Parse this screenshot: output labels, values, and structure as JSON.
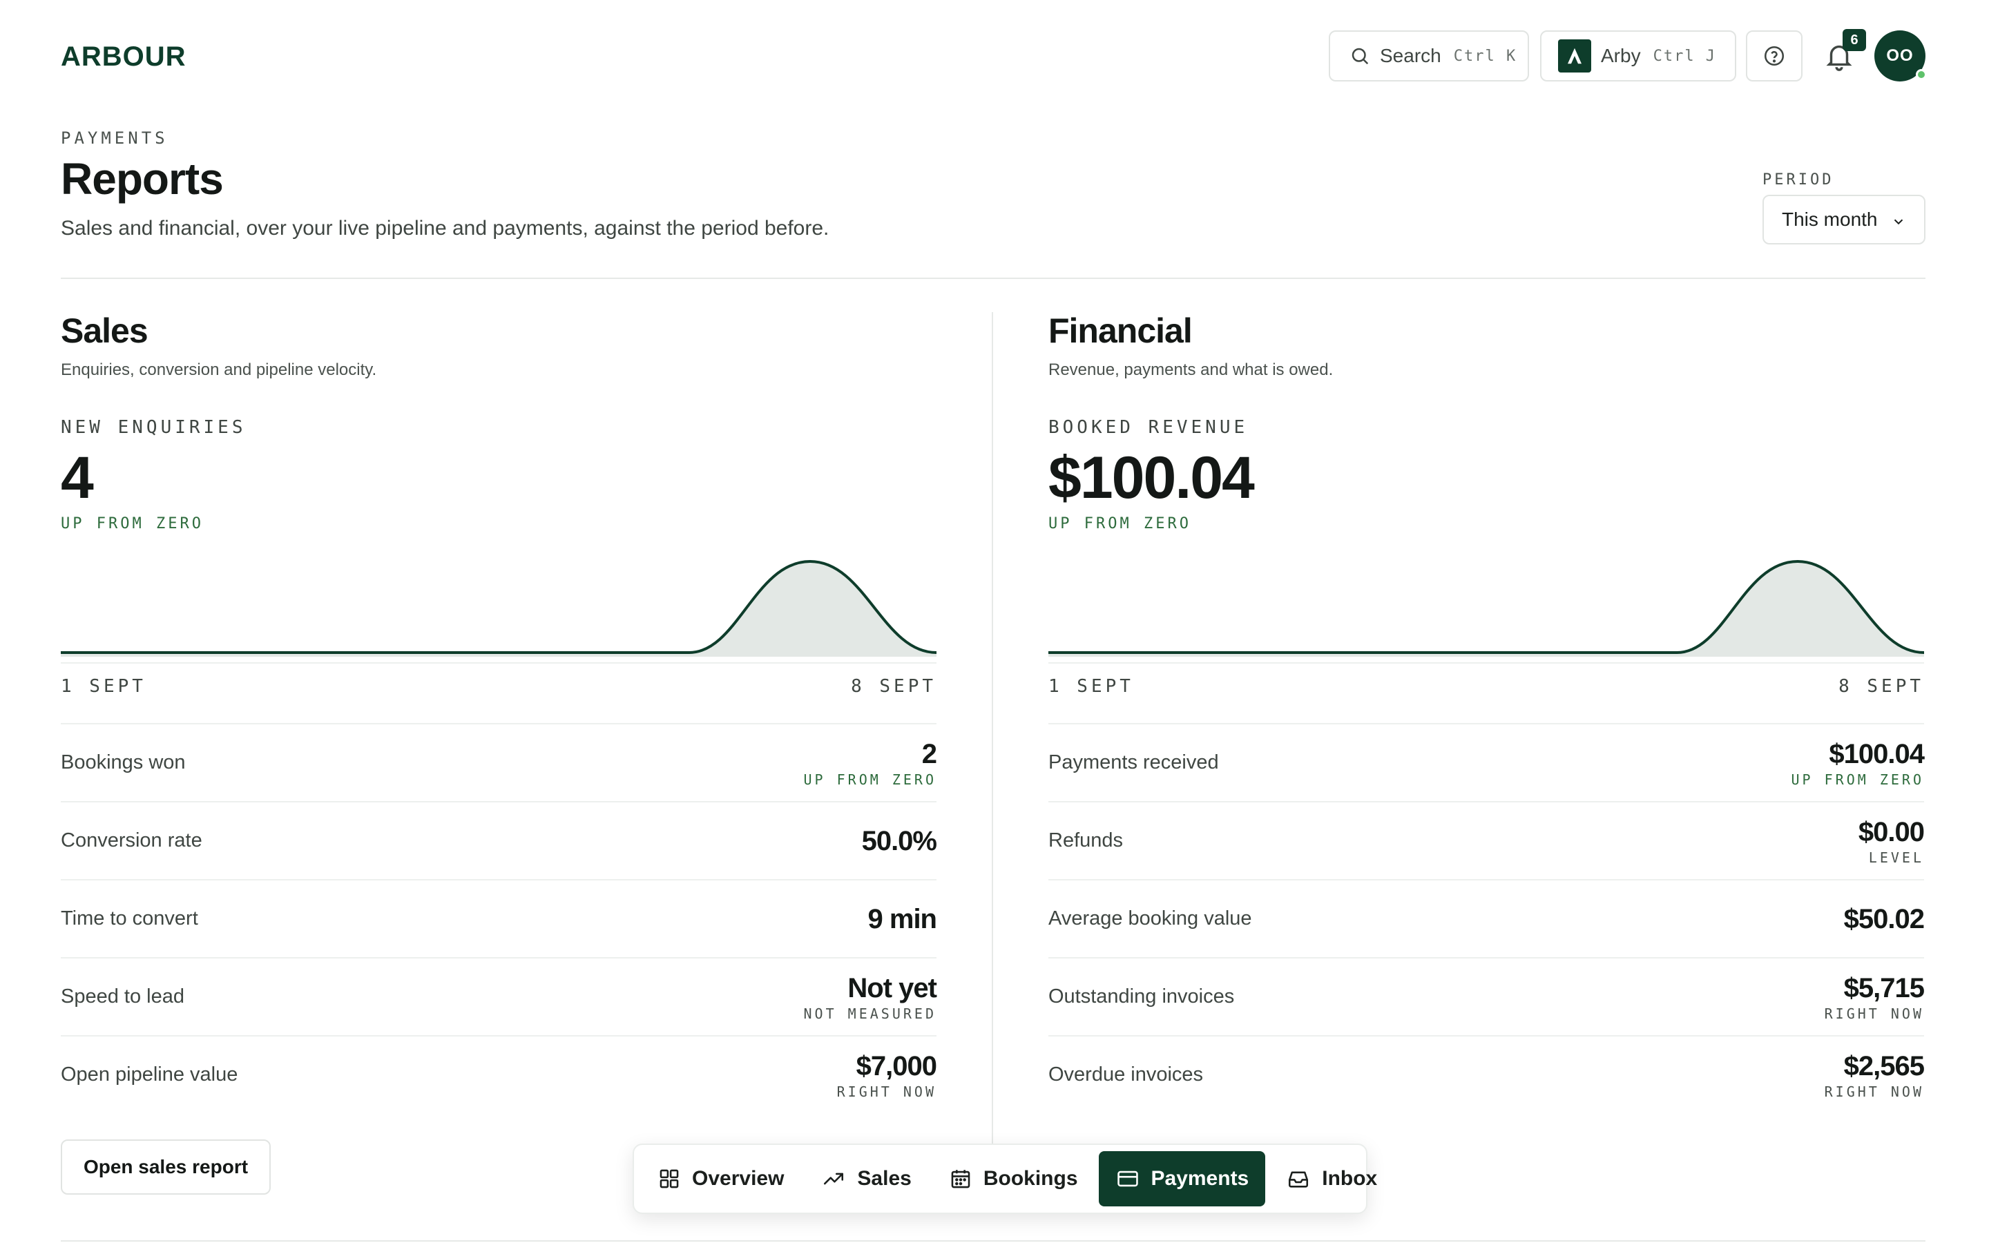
{
  "header": {
    "logo": "ARBOUR",
    "search": {
      "label": "Search",
      "shortcut": "Ctrl K"
    },
    "workspace": {
      "label": "Arby",
      "shortcut": "Ctrl J"
    },
    "notifications": {
      "count": "6"
    },
    "avatar": {
      "initials": "OO"
    }
  },
  "page": {
    "eyebrow": "PAYMENTS",
    "title": "Reports",
    "subtitle": "Sales and financial, over your live pipeline and payments, against the period before.",
    "period": {
      "label": "PERIOD",
      "value": "This month"
    }
  },
  "sales": {
    "title": "Sales",
    "subtitle": "Enquiries, conversion and pipeline velocity.",
    "kpi": {
      "label": "NEW ENQUIRIES",
      "value": "4",
      "delta": "UP FROM ZERO"
    },
    "axis": {
      "start": "1 SEPT",
      "end": "8 SEPT"
    },
    "rows": [
      {
        "label": "Bookings won",
        "value": "2",
        "note": "UP FROM ZERO"
      },
      {
        "label": "Conversion rate",
        "value": "50.0%",
        "note": ""
      },
      {
        "label": "Time to convert",
        "value": "9 min",
        "note": ""
      },
      {
        "label": "Speed to lead",
        "value": "Not yet",
        "note": "NOT MEASURED"
      },
      {
        "label": "Open pipeline value",
        "value": "$7,000",
        "note": "RIGHT NOW"
      }
    ],
    "button": "Open sales report"
  },
  "financial": {
    "title": "Financial",
    "subtitle": "Revenue, payments and what is owed.",
    "kpi": {
      "label": "BOOKED REVENUE",
      "value": "$100.04",
      "delta": "UP FROM ZERO"
    },
    "axis": {
      "start": "1 SEPT",
      "end": "8 SEPT"
    },
    "rows": [
      {
        "label": "Payments received",
        "value": "$100.04",
        "note": "UP FROM ZERO"
      },
      {
        "label": "Refunds",
        "value": "$0.00",
        "note": "LEVEL"
      },
      {
        "label": "Average booking value",
        "value": "$50.02",
        "note": ""
      },
      {
        "label": "Outstanding invoices",
        "value": "$5,715",
        "note": "RIGHT NOW"
      },
      {
        "label": "Overdue invoices",
        "value": "$2,565",
        "note": "RIGHT NOW"
      }
    ]
  },
  "nav": {
    "items": [
      {
        "label": "Overview",
        "icon": "grid-icon"
      },
      {
        "label": "Sales",
        "icon": "trend-icon"
      },
      {
        "label": "Bookings",
        "icon": "calendar-icon"
      },
      {
        "label": "Payments",
        "icon": "card-icon",
        "active": true
      },
      {
        "label": "Inbox",
        "icon": "inbox-icon"
      }
    ]
  },
  "colors": {
    "brand": "#0e3d2b",
    "positive": "#2d6b3c",
    "fill": "#e3e8e5"
  }
}
